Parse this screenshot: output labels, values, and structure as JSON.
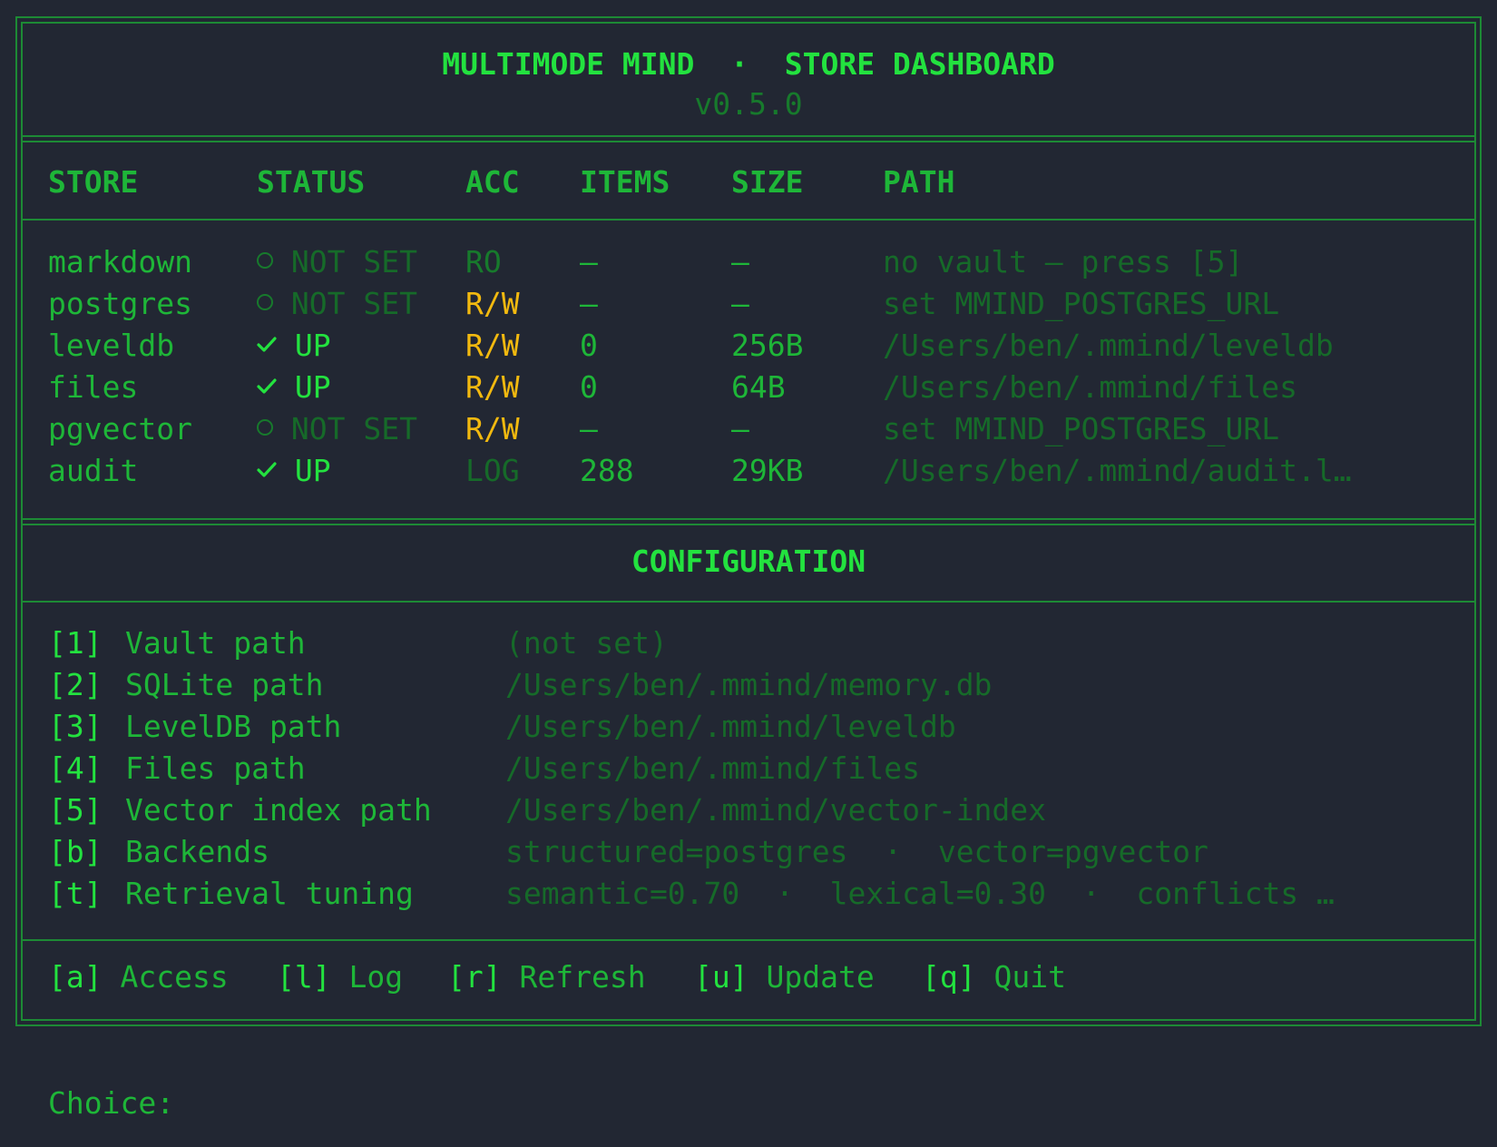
{
  "header": {
    "title": "MULTIMODE MIND  ·  STORE DASHBOARD",
    "version": "v0.5.0"
  },
  "stores": {
    "columns": [
      "STORE",
      "STATUS",
      "ACC",
      "ITEMS",
      "SIZE",
      "PATH"
    ],
    "rows": [
      {
        "store": "markdown",
        "status": "NOT SET",
        "status_icon": "circle-icon",
        "acc": "RO",
        "items": "—",
        "size": "—",
        "path": "no vault — press [5]"
      },
      {
        "store": "postgres",
        "status": "NOT SET",
        "status_icon": "circle-icon",
        "acc": "R/W",
        "items": "—",
        "size": "—",
        "path": "set MMIND_POSTGRES_URL"
      },
      {
        "store": "leveldb",
        "status": "UP",
        "status_icon": "check-icon",
        "acc": "R/W",
        "items": "0",
        "size": "256B",
        "path": "/Users/ben/.mmind/leveldb"
      },
      {
        "store": "files",
        "status": "UP",
        "status_icon": "check-icon",
        "acc": "R/W",
        "items": "0",
        "size": "64B",
        "path": "/Users/ben/.mmind/files"
      },
      {
        "store": "pgvector",
        "status": "NOT SET",
        "status_icon": "circle-icon",
        "acc": "R/W",
        "items": "—",
        "size": "—",
        "path": "set MMIND_POSTGRES_URL"
      },
      {
        "store": "audit",
        "status": "UP",
        "status_icon": "check-icon",
        "acc": "LOG",
        "items": "288",
        "size": "29KB",
        "path": "/Users/ben/.mmind/audit.l…"
      }
    ]
  },
  "configuration": {
    "title": "CONFIGURATION",
    "items": [
      {
        "key": "[1]",
        "label": "Vault path",
        "value": "(not set)"
      },
      {
        "key": "[2]",
        "label": "SQLite path",
        "value": "/Users/ben/.mmind/memory.db"
      },
      {
        "key": "[3]",
        "label": "LevelDB path",
        "value": "/Users/ben/.mmind/leveldb"
      },
      {
        "key": "[4]",
        "label": "Files path",
        "value": "/Users/ben/.mmind/files"
      },
      {
        "key": "[5]",
        "label": "Vector index path",
        "value": "/Users/ben/.mmind/vector-index"
      },
      {
        "key": "[b]",
        "label": "Backends",
        "value": "structured=postgres  ·  vector=pgvector"
      },
      {
        "key": "[t]",
        "label": "Retrieval tuning",
        "value": "semantic=0.70  ·  lexical=0.30  ·  conflicts …"
      }
    ]
  },
  "menu": [
    {
      "key": "[a]",
      "label": "Access"
    },
    {
      "key": "[l]",
      "label": "Log"
    },
    {
      "key": "[r]",
      "label": "Refresh"
    },
    {
      "key": "[u]",
      "label": "Update"
    },
    {
      "key": "[q]",
      "label": "Quit"
    }
  ],
  "prompt": "Choice:",
  "colors": {
    "background": "#222733",
    "bright_green": "#23e23f",
    "green": "#1eb638",
    "dim_green": "#177a2c",
    "yellow": "#f2b90f",
    "border": "#1d8a35"
  }
}
